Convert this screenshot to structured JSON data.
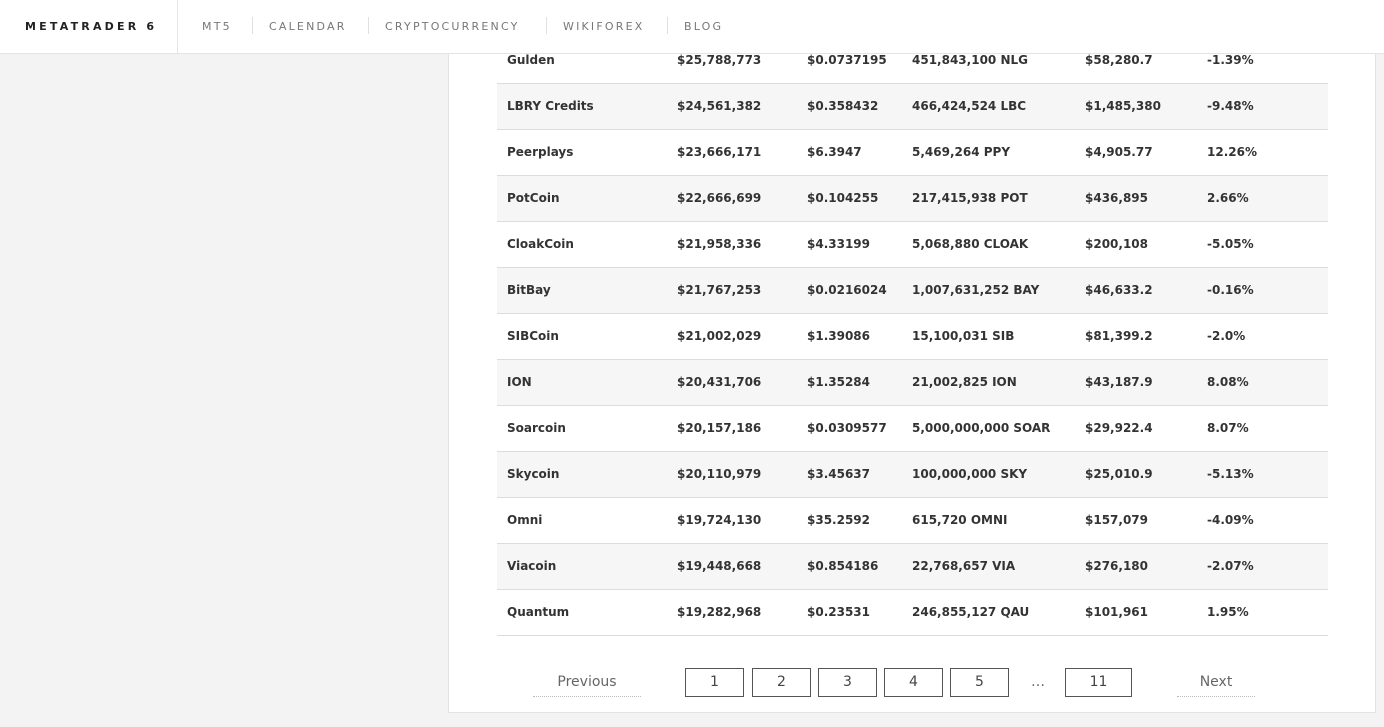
{
  "header": {
    "brand": "METATRADER 6",
    "nav": [
      "MT5",
      "CALENDAR",
      "CRYPTOCURRENCY",
      "WIKIFOREX",
      "BLOG"
    ]
  },
  "table": {
    "rows": [
      {
        "name": "Gulden",
        "market_cap": "$25,788,773",
        "price": "$0.0737195",
        "supply": "451,843,100 NLG",
        "volume": "$58,280.7",
        "change": "-1.39%"
      },
      {
        "name": "LBRY Credits",
        "market_cap": "$24,561,382",
        "price": "$0.358432",
        "supply": "466,424,524 LBC",
        "volume": "$1,485,380",
        "change": "-9.48%"
      },
      {
        "name": "Peerplays",
        "market_cap": "$23,666,171",
        "price": "$6.3947",
        "supply": "5,469,264 PPY",
        "volume": "$4,905.77",
        "change": "12.26%"
      },
      {
        "name": "PotCoin",
        "market_cap": "$22,666,699",
        "price": "$0.104255",
        "supply": "217,415,938 POT",
        "volume": "$436,895",
        "change": "2.66%"
      },
      {
        "name": "CloakCoin",
        "market_cap": "$21,958,336",
        "price": "$4.33199",
        "supply": "5,068,880 CLOAK",
        "volume": "$200,108",
        "change": "-5.05%"
      },
      {
        "name": "BitBay",
        "market_cap": "$21,767,253",
        "price": "$0.0216024",
        "supply": "1,007,631,252 BAY",
        "volume": "$46,633.2",
        "change": "-0.16%"
      },
      {
        "name": "SIBCoin",
        "market_cap": "$21,002,029",
        "price": "$1.39086",
        "supply": "15,100,031 SIB",
        "volume": "$81,399.2",
        "change": "-2.0%"
      },
      {
        "name": "ION",
        "market_cap": "$20,431,706",
        "price": "$1.35284",
        "supply": "21,002,825 ION",
        "volume": "$43,187.9",
        "change": "8.08%"
      },
      {
        "name": "Soarcoin",
        "market_cap": "$20,157,186",
        "price": "$0.0309577",
        "supply": "5,000,000,000 SOAR",
        "volume": "$29,922.4",
        "change": "8.07%"
      },
      {
        "name": "Skycoin",
        "market_cap": "$20,110,979",
        "price": "$3.45637",
        "supply": "100,000,000 SKY",
        "volume": "$25,010.9",
        "change": "-5.13%"
      },
      {
        "name": "Omni",
        "market_cap": "$19,724,130",
        "price": "$35.2592",
        "supply": "615,720 OMNI",
        "volume": "$157,079",
        "change": "-4.09%"
      },
      {
        "name": "Viacoin",
        "market_cap": "$19,448,668",
        "price": "$0.854186",
        "supply": "22,768,657 VIA",
        "volume": "$276,180",
        "change": "-2.07%"
      },
      {
        "name": "Quantum",
        "market_cap": "$19,282,968",
        "price": "$0.23531",
        "supply": "246,855,127 QAU",
        "volume": "$101,961",
        "change": "1.95%"
      }
    ]
  },
  "pagination": {
    "previous": "Previous",
    "next": "Next",
    "pages": [
      "1",
      "2",
      "3",
      "4",
      "5"
    ],
    "ellipsis": "…",
    "last": "11"
  }
}
